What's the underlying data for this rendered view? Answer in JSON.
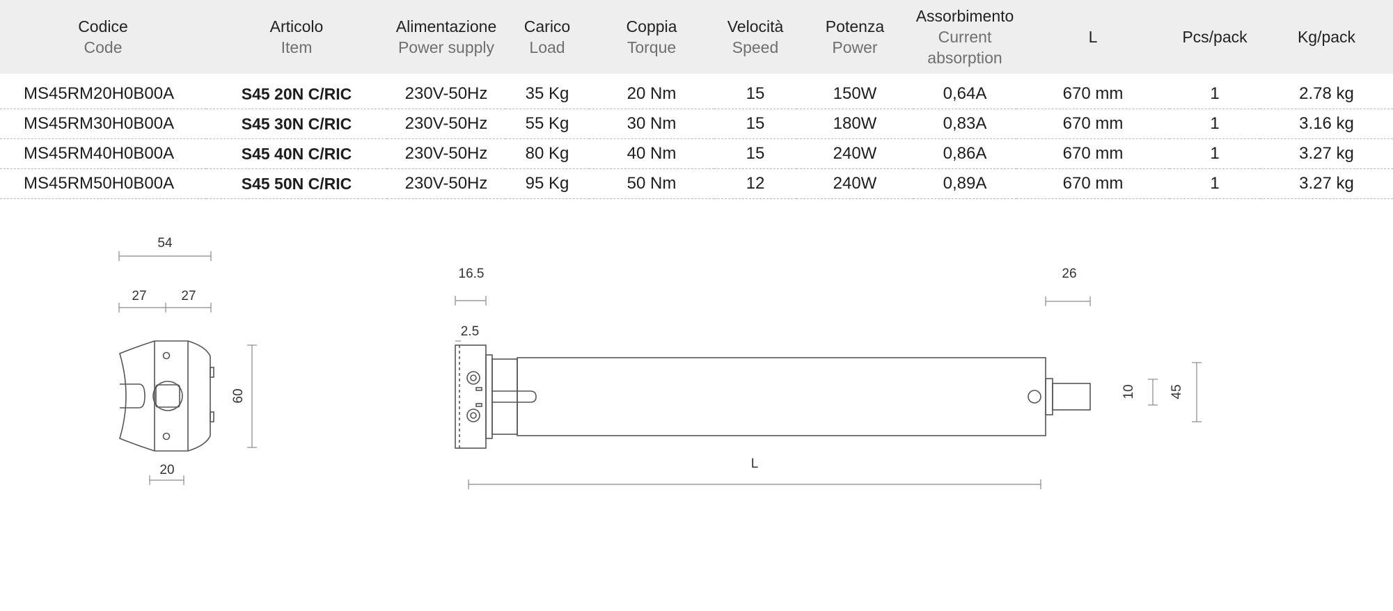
{
  "table": {
    "headers": [
      {
        "it": "Codice",
        "en": "Code"
      },
      {
        "it": "Articolo",
        "en": "Item"
      },
      {
        "it": "Alimentazione",
        "en": "Power supply"
      },
      {
        "it": "Carico",
        "en": "Load"
      },
      {
        "it": "Coppia",
        "en": "Torque"
      },
      {
        "it": "Velocità",
        "en": "Speed"
      },
      {
        "it": "Potenza",
        "en": "Power"
      },
      {
        "it": "Assorbimento",
        "en": "Current absorption"
      },
      {
        "it": "L",
        "en": ""
      },
      {
        "it": "Pcs/pack",
        "en": ""
      },
      {
        "it": "Kg/pack",
        "en": ""
      }
    ],
    "rows": [
      {
        "code": "MS45RM20H0B00A",
        "item": "S45 20N C/RIC",
        "power_supply": "230V-50Hz",
        "load": "35 Kg",
        "torque": "20 Nm",
        "speed": "15",
        "power": "150W",
        "current": "0,64A",
        "length": "670 mm",
        "pcs": "1",
        "kg": "2.78 kg"
      },
      {
        "code": "MS45RM30H0B00A",
        "item": "S45 30N C/RIC",
        "power_supply": "230V-50Hz",
        "load": "55 Kg",
        "torque": "30 Nm",
        "speed": "15",
        "power": "180W",
        "current": "0,83A",
        "length": "670 mm",
        "pcs": "1",
        "kg": "3.16 kg"
      },
      {
        "code": "MS45RM40H0B00A",
        "item": "S45 40N C/RIC",
        "power_supply": "230V-50Hz",
        "load": "80 Kg",
        "torque": "40 Nm",
        "speed": "15",
        "power": "240W",
        "current": "0,86A",
        "length": "670 mm",
        "pcs": "1",
        "kg": "3.27 kg"
      },
      {
        "code": "MS45RM50H0B00A",
        "item": "S45 50N C/RIC",
        "power_supply": "230V-50Hz",
        "load": "95 Kg",
        "torque": "50 Nm",
        "speed": "12",
        "power": "240W",
        "current": "0,89A",
        "length": "670 mm",
        "pcs": "1",
        "kg": "3.27 kg"
      }
    ]
  },
  "drawing": {
    "head_view": {
      "dim_width": "54",
      "dim_half_left": "27",
      "dim_half_right": "27",
      "dim_height": "60",
      "dim_slot": "20"
    },
    "side_view": {
      "dim_head": "16.5",
      "dim_flange": "2.5",
      "dim_shaft": "26",
      "dim_shaft_diameter": "10",
      "dim_tube_diameter": "45",
      "dim_length": "L"
    },
    "colors": {
      "line": "#555555",
      "dim": "#8a8a8a",
      "header_bg": "#eeeeee",
      "row_border": "#b9b9b9"
    }
  }
}
